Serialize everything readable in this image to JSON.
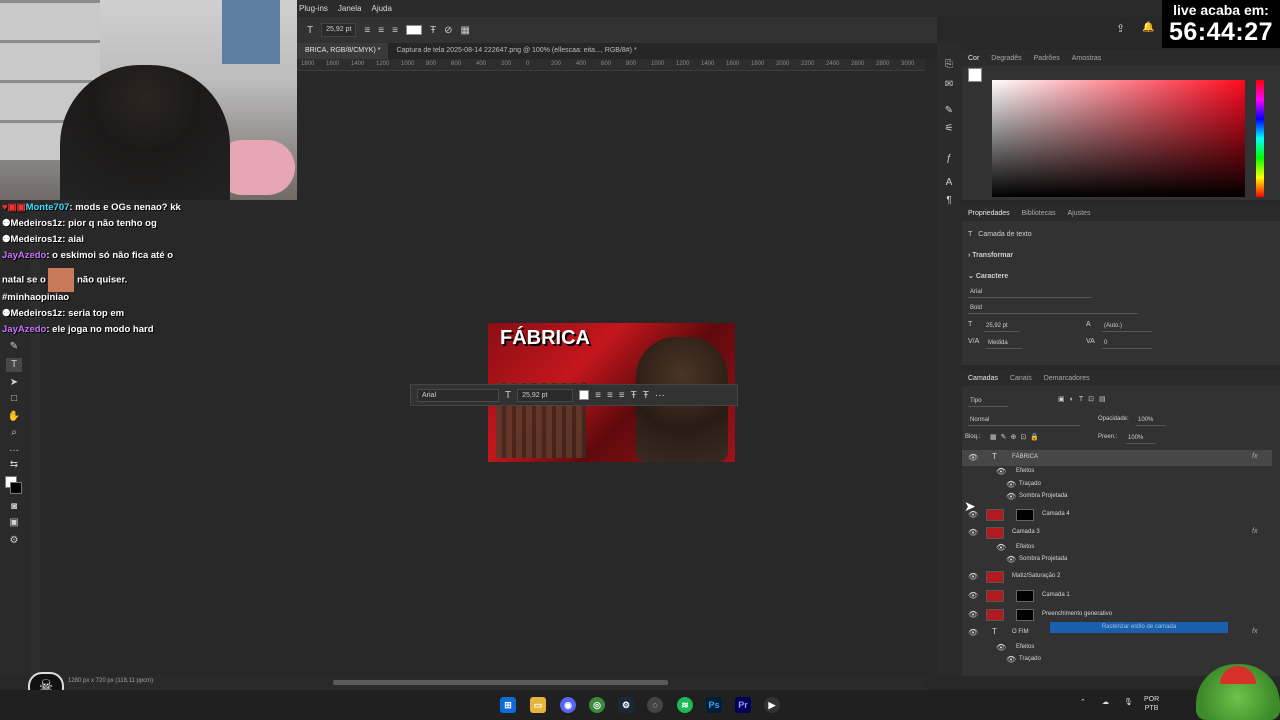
{
  "menubar": {
    "items": [
      "Plug-ins",
      "Janela",
      "Ajuda"
    ]
  },
  "optionsbar": {
    "font_size": "25,92 pt"
  },
  "tabs": [
    {
      "label": "BRICA, RGB/8/CMYK) *"
    },
    {
      "label": "Captura de tela 2025-08-14 222647.png @ 100% (ellescaa: eita..., RGB/8#) *"
    }
  ],
  "ruler": [
    "1800",
    "1600",
    "1400",
    "1200",
    "1000",
    "800",
    "600",
    "400",
    "200",
    "0",
    "200",
    "400",
    "600",
    "800",
    "1000",
    "1200",
    "1400",
    "1600",
    "1800",
    "2000",
    "2200",
    "2400",
    "2600",
    "2800",
    "3000"
  ],
  "canvas": {
    "thumb_title": "FÁBRICA",
    "floatbar": {
      "font": "Arial",
      "size": "25,92 pt"
    }
  },
  "status": "1280 px x 720 px (118,11 ppcm)",
  "color_panel": {
    "tabs": [
      "Cor",
      "Degradês",
      "Padrões",
      "Amostras"
    ]
  },
  "properties_panel": {
    "tabs": [
      "Propriedades",
      "Bibliotecas",
      "Ajustes"
    ],
    "kind": "Camada de texto",
    "transform": "Transformar",
    "character": "Caractere",
    "font": "Arial",
    "style": "Bold",
    "size": "25,92 pt",
    "leading": "(Auto.)",
    "kerning": "Medida",
    "tracking": "0"
  },
  "layers_panel": {
    "tabs": [
      "Camadas",
      "Canais",
      "Demarcadores"
    ],
    "filter": "Tipo",
    "blend": "Normal",
    "opacity_label": "Opacidade:",
    "opacity": "100%",
    "lock_label": "Bloq.:",
    "fill_label": "Preen.:",
    "fill": "100%",
    "layers": [
      {
        "name": "FÁBRICA",
        "kind": "text",
        "fx": "fx"
      },
      {
        "name": "Efeitos",
        "kind": "effects"
      },
      {
        "name": "Traçado",
        "kind": "effect"
      },
      {
        "name": "Sombra Projetada",
        "kind": "effect"
      },
      {
        "name": "Camada 4",
        "kind": "masked"
      },
      {
        "name": "Camada 3",
        "kind": "image",
        "fx": "fx"
      },
      {
        "name": "Efeitos",
        "kind": "effects"
      },
      {
        "name": "Sombra Projetada",
        "kind": "effect"
      },
      {
        "name": "Matiz/Saturação 2",
        "kind": "adjust"
      },
      {
        "name": "Camada 1",
        "kind": "masked"
      },
      {
        "name": "Preenchimento generativo",
        "kind": "masked"
      },
      {
        "name": "O FIM",
        "kind": "text",
        "fx": "fx"
      },
      {
        "name": "Efeitos",
        "kind": "effects"
      },
      {
        "name": "Traçado",
        "kind": "effect"
      }
    ],
    "tooltip": "Rasterizar estilo de camada"
  },
  "chat": [
    {
      "nick": "Monte707",
      "msg": "mods e OGs nenao? kk",
      "color": "cyan"
    },
    {
      "nick": "Medeiros1z",
      "msg": "pior q não tenho og",
      "color": "white"
    },
    {
      "nick": "Medeiros1z",
      "msg": "aiai",
      "color": "white"
    },
    {
      "nick": "JayAzedo",
      "msg": "o eskimoi só não fica até o",
      "color": "purple"
    },
    {
      "nick": "",
      "msg": "natal se o",
      "msg2": "não quiser.",
      "color": "white"
    },
    {
      "nick": "",
      "msg": "#minhaopiniao",
      "color": "white"
    },
    {
      "nick": "Medeiros1z",
      "msg": "seria top em",
      "color": "white"
    },
    {
      "nick": "JayAzedo",
      "msg": "ele joga no modo hard",
      "color": "purple"
    }
  ],
  "timer": {
    "label": "live acaba em:",
    "value": "56:44:27"
  },
  "taskbar": {
    "lang1": "POR",
    "lang2": "PTB"
  }
}
